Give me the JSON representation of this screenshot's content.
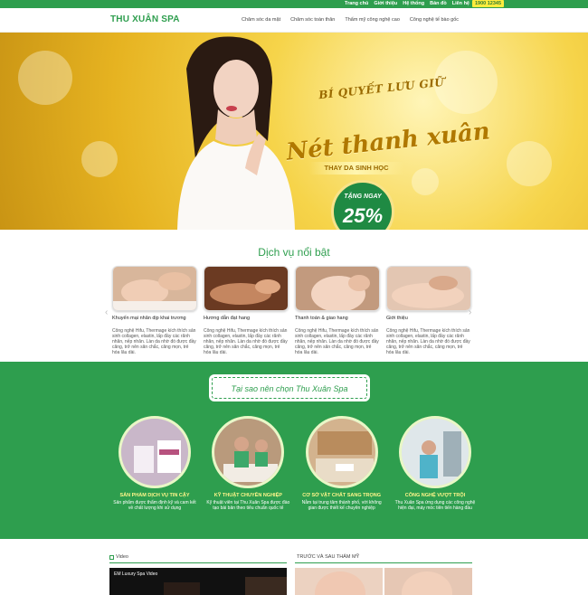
{
  "topbar": {
    "links": [
      "Trang chủ",
      "Giới thiệu",
      "Hệ thống",
      "Bản đồ",
      "Liên hệ"
    ],
    "hotline": "1900 12345",
    "colors": {
      "brand": "#2e9e4e",
      "hotline_bg": "#ffec3d"
    }
  },
  "header": {
    "logo": "THU XUÂN SPA",
    "nav": [
      "Chăm sóc da mặt",
      "Chăm sóc toàn thân",
      "Thẩm mỹ công nghệ cao",
      "Công nghệ tế bào gốc"
    ]
  },
  "hero": {
    "line1": "BÍ QUYẾT LƯU GIỮ",
    "line2": "Nét thanh xuân",
    "line3": "THAY DA SINH HỌC",
    "discount_label": "TẶNG NGAY",
    "discount_value": "25%"
  },
  "services": {
    "title": "Dịch vụ nổi bật",
    "items": [
      {
        "name": "Khuyến mại nhân dịp khai trương",
        "desc": "Công nghệ Hifu, Thermage kích thích sản sinh collagen, elastin, lấp đầy các rãnh nhăn, nếp nhăn. Làn da nhờ đó được đầy căng, trở nên săn chắc, căng mọn, trẻ hóa lâu dài."
      },
      {
        "name": "Hương dẫn đạt hang",
        "desc": "Công nghệ Hifu, Thermage kích thích sản sinh collagen, elastin, lấp đầy các rãnh nhăn, nếp nhăn. Làn da nhờ đó được đầy căng, trở nên săn chắc, căng mọn, trẻ hóa lâu dài."
      },
      {
        "name": "Thanh toán & giao hang",
        "desc": "Công nghệ Hifu, Thermage kích thích sản sinh collagen, elastin, lấp đầy các rãnh nhăn, nếp nhăn. Làn da nhờ đó được đầy căng, trở nên săn chắc, căng mọn, trẻ hóa lâu dài."
      },
      {
        "name": "Giới thiệu",
        "desc": "Công nghệ Hifu, Thermage kích thích sản sinh collagen, elastin, lấp đầy các rãnh nhăn, nếp nhăn. Làn da nhờ đó được đầy căng, trở nên săn chắc, căng mọn, trẻ hóa lâu dài."
      }
    ]
  },
  "why": {
    "title": "Tại sao nên chọn Thu Xuân Spa",
    "items": [
      {
        "heading": "SẢN PHẨM DỊCH VỤ TIN CẬY",
        "desc": "Sản phẩm được thẩm định kỹ và cam kết về chất lượng khi sử dụng"
      },
      {
        "heading": "KỸ THUẬT CHUYÊN NGHIỆP",
        "desc": "Kỹ thuật viên tại Thu Xuân Spa được đào tạo bài bản theo tiêu chuẩn quốc tế"
      },
      {
        "heading": "CƠ SỞ VẬT CHẤT SANG TRỌNG",
        "desc": "Nằm tại trung tâm thành phố, với không gian được thiết kế chuyên nghiệp"
      },
      {
        "heading": "CÔNG NGHỆ VƯỢT TRỘI",
        "desc": "Thu Xuân Spa ứng dụng các công nghệ hiện đại, máy móc tiên tiến hàng đầu"
      }
    ]
  },
  "bottom": {
    "video_heading": "Video",
    "video_title": "EM Luxury Spa Video",
    "ba_heading": "TRƯỚC VÀ SAU THẨM MỸ"
  }
}
